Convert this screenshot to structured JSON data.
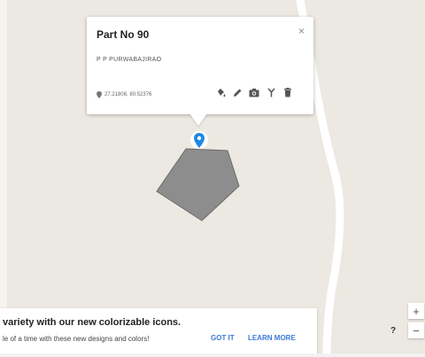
{
  "info_window": {
    "title": "Part No 90",
    "subtitle": "P P PURWABAJIRAO",
    "coordinates": "27.21808, 80.52376",
    "close_glyph": "×",
    "tools": [
      "paint-bucket-icon",
      "pencil-icon",
      "camera-icon",
      "fork-icon",
      "trash-icon"
    ]
  },
  "banner": {
    "line1": "variety with our new colorizable icons.",
    "line2": "le of a time with these new designs and colors!",
    "got_it": "GOT IT",
    "learn_more": "LEARN MORE"
  },
  "controls": {
    "zoom_in": "+",
    "zoom_out": "−",
    "help": "?"
  },
  "colors": {
    "map_background": "#ebe9e1",
    "road": "#ffffff",
    "polygon_fill": "#8d8d8d",
    "polygon_stroke": "#6a6a6a",
    "marker": "#1e88e5",
    "link": "#3d7bd8"
  }
}
